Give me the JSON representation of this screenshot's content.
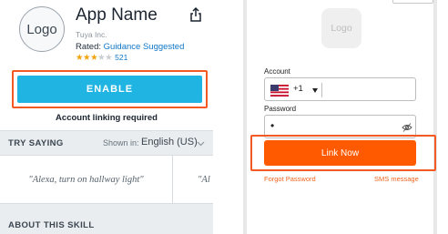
{
  "skill": {
    "logo_text": "Logo",
    "app_name": "App Name",
    "developer": "Tuya Inc.",
    "rated_prefix": "Rated: ",
    "rating_label": "Guidance Suggested",
    "stars_filled": 3,
    "stars_total": 5,
    "review_count": "521",
    "enable_label": "ENABLE",
    "linking_required": "Account linking required",
    "try_saying_label": "TRY SAYING",
    "shown_in_label": "Shown in:",
    "language": "English (US)",
    "utterances": [
      "\"Alexa, turn on hallway light\"",
      "\"Al"
    ],
    "about_label": "ABOUT THIS SKILL"
  },
  "login": {
    "logo_text": "Logo",
    "account_label": "Account",
    "country_code": "+1",
    "password_label": "Password",
    "password_mask": "•",
    "link_button": "Link Now",
    "forgot_password": "Forgot Password",
    "sms_message": "SMS message"
  },
  "colors": {
    "enable_button": "#1fb4e2",
    "highlight_outline": "#f15a22",
    "link_button": "#ff5a00",
    "link_text": "#0f76c6",
    "star": "#f0a30a"
  }
}
